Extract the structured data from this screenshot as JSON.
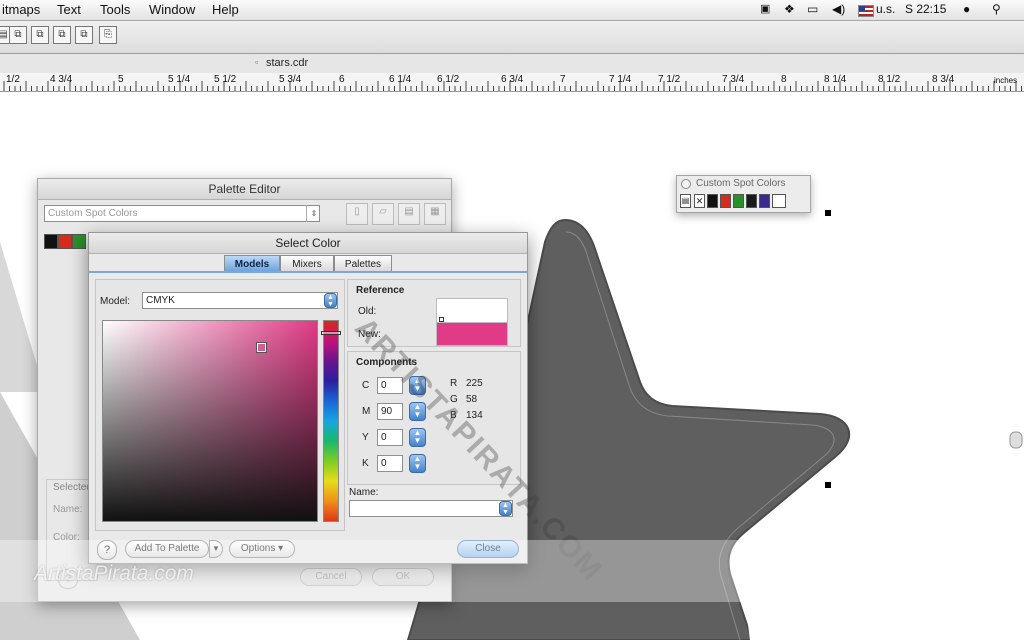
{
  "menubar": {
    "items": [
      "itmaps",
      "Text",
      "Tools",
      "Window",
      "Help"
    ],
    "region": "u.s.",
    "clock": "S 22:15"
  },
  "document": {
    "title": "stars.cdr"
  },
  "ruler": {
    "ticks": [
      "1/2",
      "4 3/4",
      "5",
      "5 1/4",
      "5 1/2",
      "5 3/4",
      "6",
      "6 1/4",
      "6 1/2",
      "6 3/4",
      "7",
      "7 1/4",
      "7 1/2",
      "7 3/4",
      "8",
      "8 1/4",
      "8 1/2",
      "8 3/4"
    ],
    "units": "inches"
  },
  "palette_editor": {
    "title": "Palette Editor",
    "palette_name": "Custom Spot Colors",
    "selected_label": "Selected",
    "name_label": "Name:",
    "color_label": "Color:",
    "cancel_label": "Cancel",
    "ok_label": "OK",
    "swatches": [
      "#111111",
      "#d62b1c",
      "#2a8f2a"
    ]
  },
  "select_color": {
    "title": "Select Color",
    "tabs": {
      "models": "Models",
      "mixers": "Mixers",
      "palettes": "Palettes"
    },
    "model_label": "Model:",
    "model_value": "CMYK",
    "reference_label": "Reference",
    "old_label": "Old:",
    "new_label": "New:",
    "old_color": "#ffffff",
    "new_color": "#e13a86",
    "components_label": "Components",
    "c_label": "C",
    "c_value": "0",
    "m_label": "M",
    "m_value": "90",
    "y_label": "Y",
    "y_value": "0",
    "k_label": "K",
    "k_value": "0",
    "r_label": "R",
    "r_value": "225",
    "g_label": "G",
    "g_value": "58",
    "b_label": "B",
    "b_value": "134",
    "name_label": "Name:",
    "name_value": "",
    "help_label": "?",
    "add_label": "Add To Palette",
    "options_label": "Options",
    "close_label": "Close"
  },
  "spot_colors": {
    "title": "Custom Spot Colors",
    "swatches": [
      "#111111",
      "#d62b1c",
      "#2a8f2a",
      "#1a1a1a",
      "#3b2a8f",
      "#ffffff"
    ]
  },
  "watermarks": {
    "diagonal": "ARTISTAPIRATA.COM",
    "bottom": "ArtistaPirata.com"
  }
}
